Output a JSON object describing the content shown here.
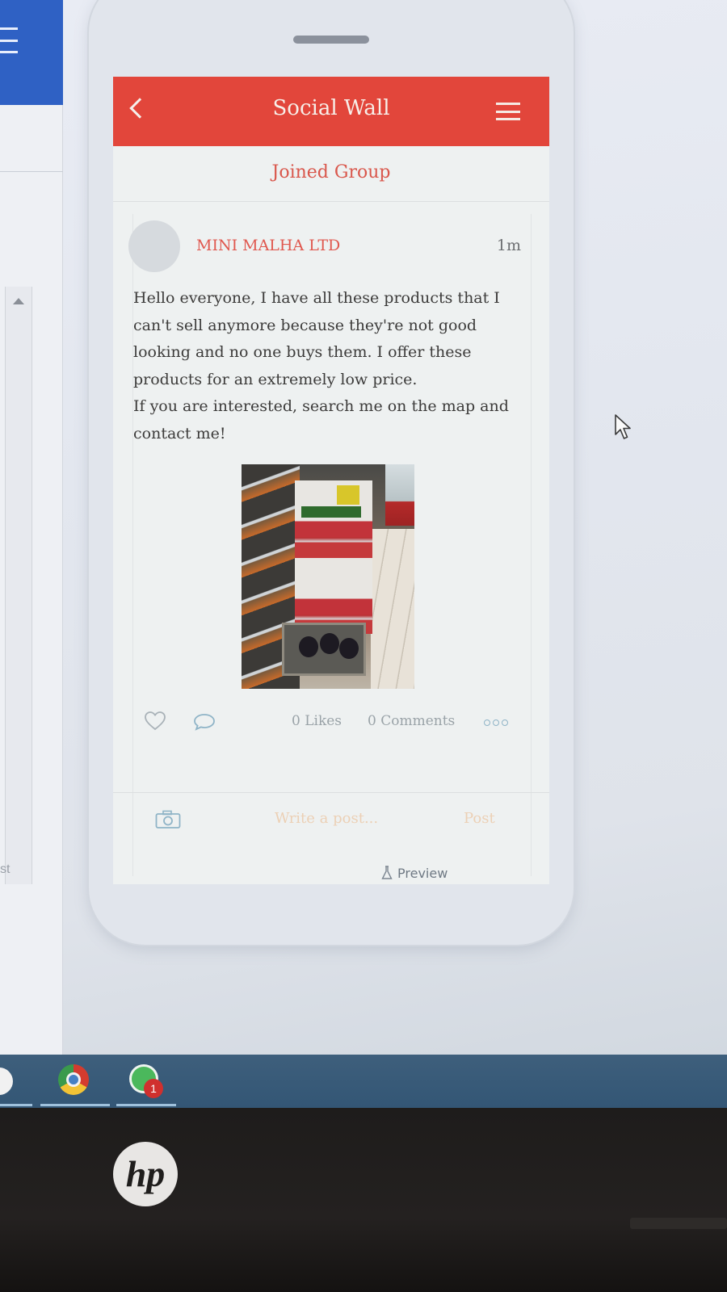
{
  "app": {
    "title": "Social Wall",
    "group_label": "Joined Group"
  },
  "post": {
    "author": "MINI MALHA LTD",
    "time": "1m",
    "text_lines": [
      "Hello everyone, I have all these products that I",
      "can't sell anymore because they're not good",
      "looking and no one buys them. I offer these",
      "products for an extremely low price.",
      "If you are interested, search me on the map and",
      "contact me!"
    ],
    "likes": "0 Likes",
    "comments": "0 Comments"
  },
  "composer": {
    "placeholder": "Write a post...",
    "post_label": "Post"
  },
  "preview_label": "Preview",
  "left_app": {
    "cut_text": "st"
  },
  "taskbar": {
    "whatsapp_badge": "1"
  },
  "brand": {
    "logo_text": "hp"
  },
  "colors": {
    "header": "#e2463b",
    "accent_text": "#e0584f",
    "taskbar": "#3e5f7c"
  },
  "icons": [
    "back-icon",
    "menu-icon",
    "heart-icon",
    "comment-icon",
    "more-icon",
    "camera-icon",
    "flask-icon",
    "cursor-icon",
    "chrome-icon",
    "whatsapp-icon"
  ]
}
